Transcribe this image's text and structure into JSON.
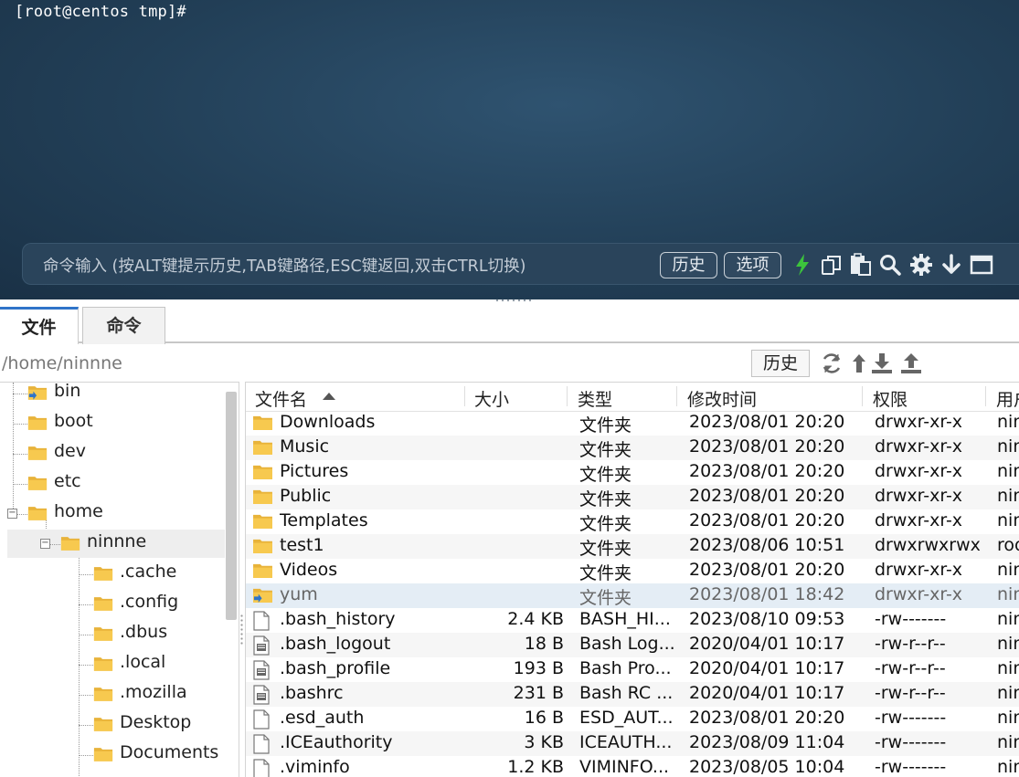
{
  "terminal": {
    "prompt": "[root@centos tmp]#",
    "command_hint": "命令输入 (按ALT键提示历史,TAB键路径,ESC键返回,双击CTRL切换)",
    "history_button": "历史",
    "options_button": "选项",
    "toolbar_icons": [
      "lightning-icon",
      "copy-icon",
      "paste-icon",
      "search-icon",
      "gear-icon",
      "download-arrow-icon",
      "maximize-icon"
    ]
  },
  "tabs": [
    {
      "label": "文件",
      "active": true
    },
    {
      "label": "命令",
      "active": false
    }
  ],
  "pathbar": {
    "path": "/home/ninnne",
    "history_button": "历史",
    "icons": [
      "refresh-icon",
      "up-arrow-icon",
      "download-icon",
      "upload-icon"
    ]
  },
  "tree": {
    "items": [
      {
        "label": "bin",
        "level": 0
      },
      {
        "label": "boot",
        "level": 0
      },
      {
        "label": "dev",
        "level": 0
      },
      {
        "label": "etc",
        "level": 0
      },
      {
        "label": "home",
        "level": 0,
        "expanded": true
      },
      {
        "label": "ninnne",
        "level": 1,
        "expanded": true,
        "selected": true
      },
      {
        "label": ".cache",
        "level": 2
      },
      {
        "label": ".config",
        "level": 2
      },
      {
        "label": ".dbus",
        "level": 2
      },
      {
        "label": ".local",
        "level": 2
      },
      {
        "label": ".mozilla",
        "level": 2
      },
      {
        "label": "Desktop",
        "level": 2
      },
      {
        "label": "Documents",
        "level": 2
      }
    ]
  },
  "filelist": {
    "columns": {
      "name": "文件名",
      "size": "大小",
      "type": "类型",
      "modified": "修改时间",
      "permissions": "权限",
      "owner": "用户"
    },
    "rows": [
      {
        "name": "Downloads",
        "size": "",
        "type": "文件夹",
        "modified": "2023/08/01 20:20",
        "perm": "drwxr-xr-x",
        "owner": "nin",
        "kind": "folder"
      },
      {
        "name": "Music",
        "size": "",
        "type": "文件夹",
        "modified": "2023/08/01 20:20",
        "perm": "drwxr-xr-x",
        "owner": "nin",
        "kind": "folder"
      },
      {
        "name": "Pictures",
        "size": "",
        "type": "文件夹",
        "modified": "2023/08/01 20:20",
        "perm": "drwxr-xr-x",
        "owner": "nin",
        "kind": "folder"
      },
      {
        "name": "Public",
        "size": "",
        "type": "文件夹",
        "modified": "2023/08/01 20:20",
        "perm": "drwxr-xr-x",
        "owner": "nin",
        "kind": "folder"
      },
      {
        "name": "Templates",
        "size": "",
        "type": "文件夹",
        "modified": "2023/08/01 20:20",
        "perm": "drwxr-xr-x",
        "owner": "nin",
        "kind": "folder"
      },
      {
        "name": "test1",
        "size": "",
        "type": "文件夹",
        "modified": "2023/08/06 10:51",
        "perm": "drwxrwxrwx",
        "owner": "roo",
        "kind": "folder"
      },
      {
        "name": "Videos",
        "size": "",
        "type": "文件夹",
        "modified": "2023/08/01 20:20",
        "perm": "drwxr-xr-x",
        "owner": "nin",
        "kind": "folder"
      },
      {
        "name": "yum",
        "size": "",
        "type": "文件夹",
        "modified": "2023/08/01 18:42",
        "perm": "drwxr-xr-x",
        "owner": "nin",
        "kind": "link-folder",
        "selected": true
      },
      {
        "name": ".bash_history",
        "size": "2.4 KB",
        "type": "BASH_HI...",
        "modified": "2023/08/10 09:53",
        "perm": "-rw-------",
        "owner": "nin",
        "kind": "file"
      },
      {
        "name": ".bash_logout",
        "size": "18 B",
        "type": "Bash Log...",
        "modified": "2020/04/01 10:17",
        "perm": "-rw-r--r--",
        "owner": "nin",
        "kind": "script"
      },
      {
        "name": ".bash_profile",
        "size": "193 B",
        "type": "Bash Pro...",
        "modified": "2020/04/01 10:17",
        "perm": "-rw-r--r--",
        "owner": "nin",
        "kind": "script"
      },
      {
        "name": ".bashrc",
        "size": "231 B",
        "type": "Bash RC ...",
        "modified": "2020/04/01 10:17",
        "perm": "-rw-r--r--",
        "owner": "nin",
        "kind": "script"
      },
      {
        "name": ".esd_auth",
        "size": "16 B",
        "type": "ESD_AUT...",
        "modified": "2023/08/01 20:20",
        "perm": "-rw-------",
        "owner": "nin",
        "kind": "file"
      },
      {
        "name": ".ICEauthority",
        "size": "3 KB",
        "type": "ICEAUTH...",
        "modified": "2023/08/09 11:04",
        "perm": "-rw-------",
        "owner": "nin",
        "kind": "file"
      },
      {
        "name": ".viminfo",
        "size": "1.2 KB",
        "type": "VIMINFO...",
        "modified": "2023/08/05 10:04",
        "perm": "-rw-------",
        "owner": "nin",
        "kind": "file"
      }
    ]
  },
  "colors": {
    "terminal_bg": "#223f57",
    "folder": "#f5c44e",
    "tab_active_accent": "#2f74c9",
    "lightning": "#3cc43c",
    "selected_row": "#e4edf5"
  }
}
